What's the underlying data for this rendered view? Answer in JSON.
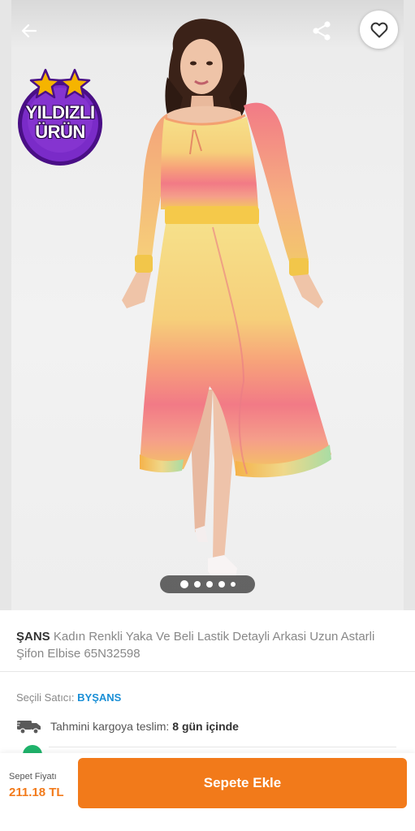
{
  "product": {
    "brand": "ŞANS",
    "title": "Kadın Renkli Yaka Ve Beli Lastik Detayli Arkasi Uzun Astarli Şifon Elbise 65N32598"
  },
  "badge": {
    "line1": "YILDIZLI",
    "line2": "ÜRÜN"
  },
  "gallery": {
    "image_count": 5,
    "active_index": 1
  },
  "seller": {
    "label": "Seçili Satıcı:",
    "name": "BYŞANS"
  },
  "delivery": {
    "label": "Tahmini kargoya teslim:",
    "value": "8 gün içinde"
  },
  "cart": {
    "price_label": "Sepet Fiyatı",
    "price": "211.18 TL",
    "button_label": "Sepete Ekle"
  },
  "icons": {
    "back": "arrow-left-icon",
    "share": "share-icon",
    "favorite": "heart-icon",
    "delivery": "truck-icon"
  },
  "colors": {
    "accent": "#f27a1a",
    "seller_link": "#1a8fd6",
    "badge_purple": "#6a1fb0",
    "badge_star": "#f5b400"
  }
}
